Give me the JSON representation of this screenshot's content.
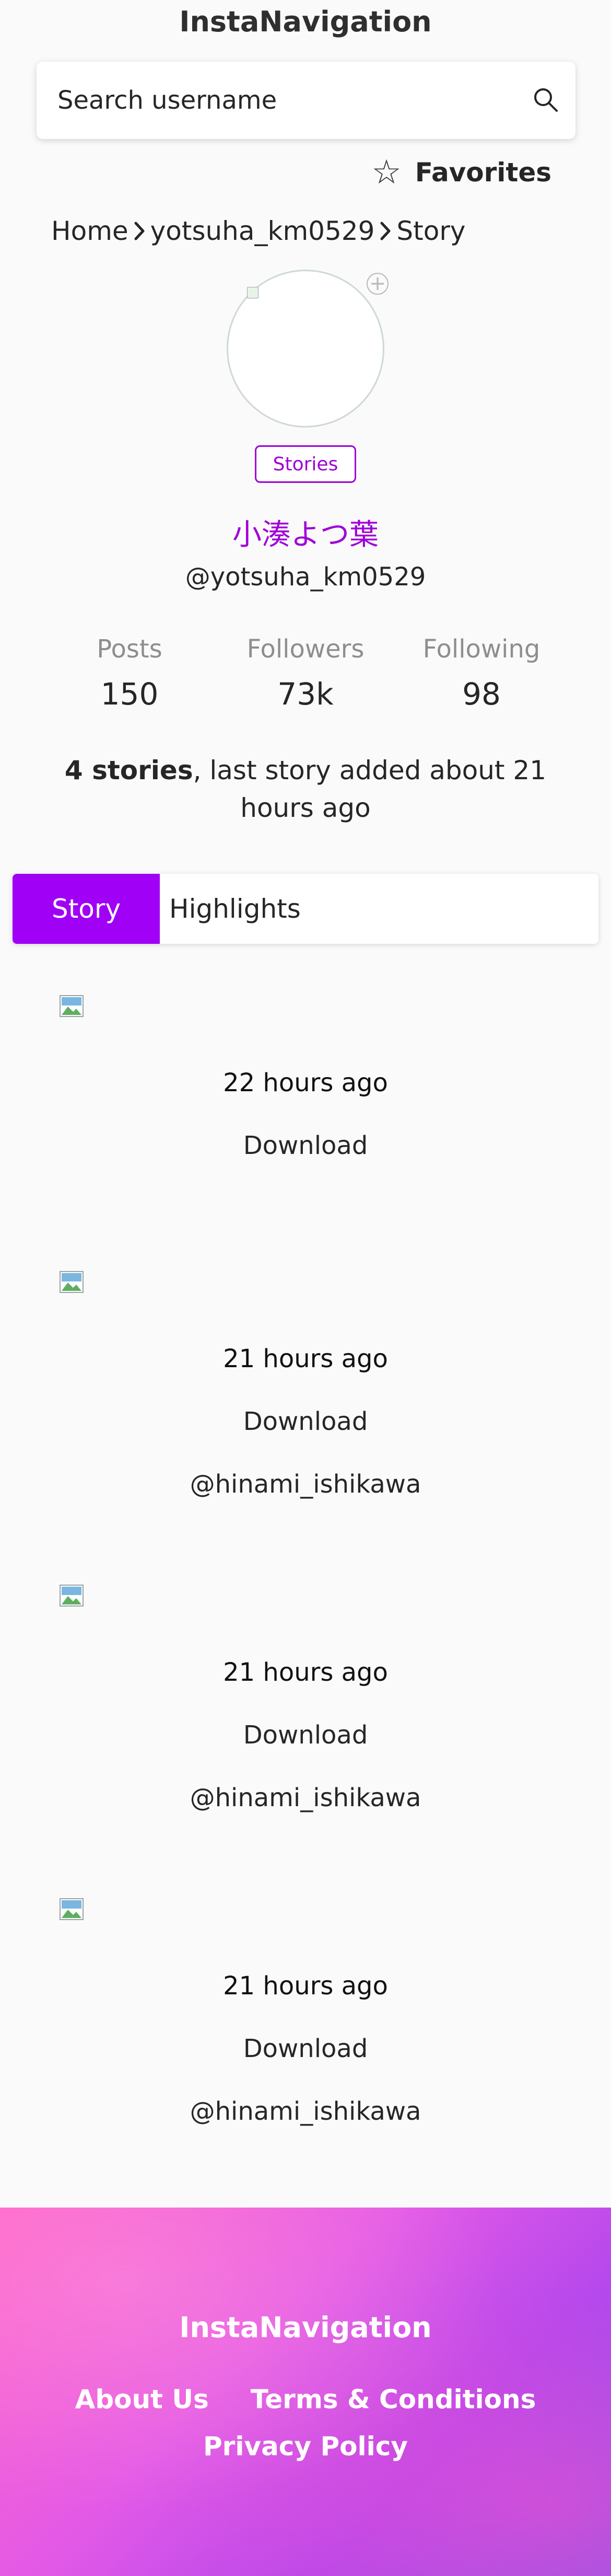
{
  "header": {
    "title": "InstaNavigation"
  },
  "search": {
    "placeholder": "Search username"
  },
  "favorites": {
    "label": "Favorites",
    "icon": "star-outline-icon"
  },
  "breadcrumb": {
    "home": "Home",
    "user": "yotsuha_km0529",
    "current": "Story"
  },
  "profile": {
    "stories_badge": "Stories",
    "full_name": "小湊よつ葉",
    "username": "@yotsuha_km0529",
    "accent_color": "#a000d8"
  },
  "stats": {
    "posts_label": "Posts",
    "posts_value": "150",
    "followers_label": "Followers",
    "followers_value": "73k",
    "following_label": "Following",
    "following_value": "98"
  },
  "summary": {
    "count_text": "4 stories",
    "rest_text": ", last story added about 21 hours ago"
  },
  "tabs": [
    {
      "label": "Story",
      "active": true
    },
    {
      "label": "Highlights",
      "active": false
    }
  ],
  "stories": [
    {
      "time": "22 hours ago",
      "download": "Download",
      "mention": ""
    },
    {
      "time": "21 hours ago",
      "download": "Download",
      "mention": "@hinami_ishikawa"
    },
    {
      "time": "21 hours ago",
      "download": "Download",
      "mention": "@hinami_ishikawa"
    },
    {
      "time": "21 hours ago",
      "download": "Download",
      "mention": "@hinami_ishikawa"
    }
  ],
  "footer": {
    "title": "InstaNavigation",
    "about": "About Us",
    "terms": "Terms & Conditions",
    "privacy": "Privacy Policy"
  }
}
